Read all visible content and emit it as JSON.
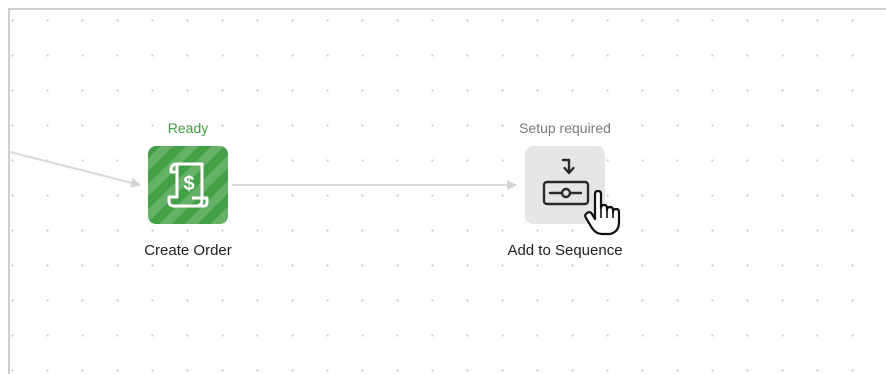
{
  "nodes": [
    {
      "status": "Ready",
      "label": "Create Order",
      "icon": "receipt-dollar-icon",
      "status_color": "#3e9e3e",
      "tile_color": "#44a047"
    },
    {
      "status": "Setup required",
      "label": "Add to Sequence",
      "icon": "add-to-sequence-icon",
      "status_color": "#7a7a7a",
      "tile_color": "#e6e6e8"
    }
  ],
  "cursor": "hand-pointer-icon",
  "connector_color": "#d9d9d9"
}
